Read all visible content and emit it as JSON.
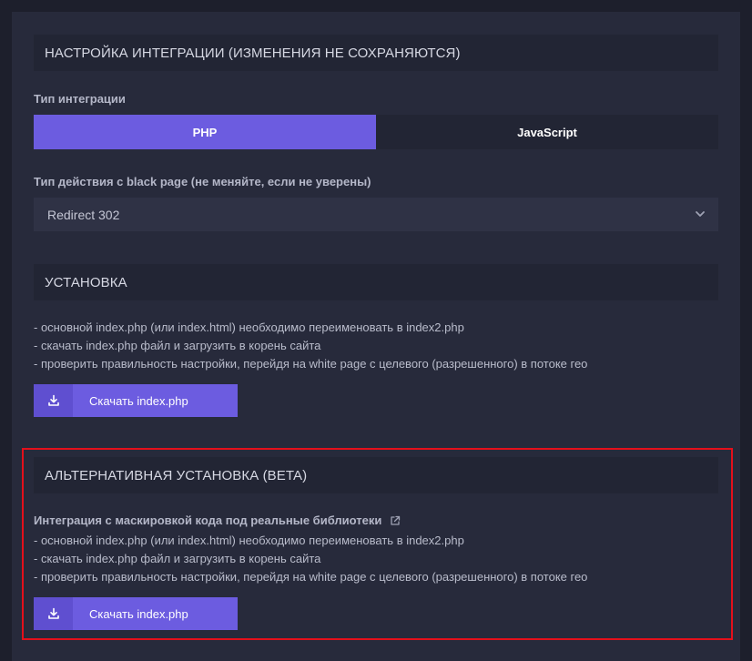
{
  "integration_settings": {
    "title": "НАСТРОЙКА ИНТЕГРАЦИИ (ИЗМЕНЕНИЯ НЕ СОХРАНЯЮТСЯ)",
    "type_label": "Тип интеграции",
    "type_options": [
      "PHP",
      "JavaScript"
    ],
    "type_selected": "PHP",
    "action_label": "Тип действия с black page (не меняйте, если не уверены)",
    "action_value": "Redirect 302"
  },
  "install": {
    "title": "УСТАНОВКА",
    "steps": [
      "- основной index.php (или index.html) необходимо переименовать в index2.php",
      "- скачать index.php файл и загрузить в корень сайта",
      "- проверить правильность настройки, перейдя на white page с целевого (разрешенного) в потоке гео"
    ],
    "download_label": "Скачать index.php"
  },
  "alt_install": {
    "title": "АЛЬТЕРНАТИВНАЯ УСТАНОВКА (BETA)",
    "subtitle": "Интеграция с маскировкой кода под реальные библиотеки",
    "steps": [
      "- основной index.php (или index.html) необходимо переименовать в index2.php",
      "- скачать index.php файл и загрузить в корень сайта",
      "- проверить правильность настройки, перейдя на white page с целевого (разрешенного) в потоке гео"
    ],
    "download_label": "Скачать index.php"
  },
  "colors": {
    "accent": "#6c5ce0",
    "highlight_border": "#e3101b"
  }
}
